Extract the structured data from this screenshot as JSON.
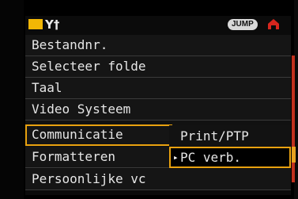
{
  "header": {
    "settings_icon": "Υ†",
    "jump_label": "JUMP",
    "print_icon": "print-icon",
    "accent_color": "#f2b705"
  },
  "menu": {
    "items": [
      {
        "label": "Bestandnr."
      },
      {
        "label": "Selecteer folde"
      },
      {
        "label": "Taal"
      },
      {
        "label": "Video Systeem"
      },
      {
        "label": "Communicatie"
      },
      {
        "label": "Formatteren"
      },
      {
        "label": "Persoonlijke vc"
      }
    ],
    "highlight_color": "#e8a10f"
  },
  "submenu": {
    "options": [
      {
        "label": "Print/PTP"
      },
      {
        "label": "PC verb."
      }
    ],
    "selected_marker": "▸"
  }
}
